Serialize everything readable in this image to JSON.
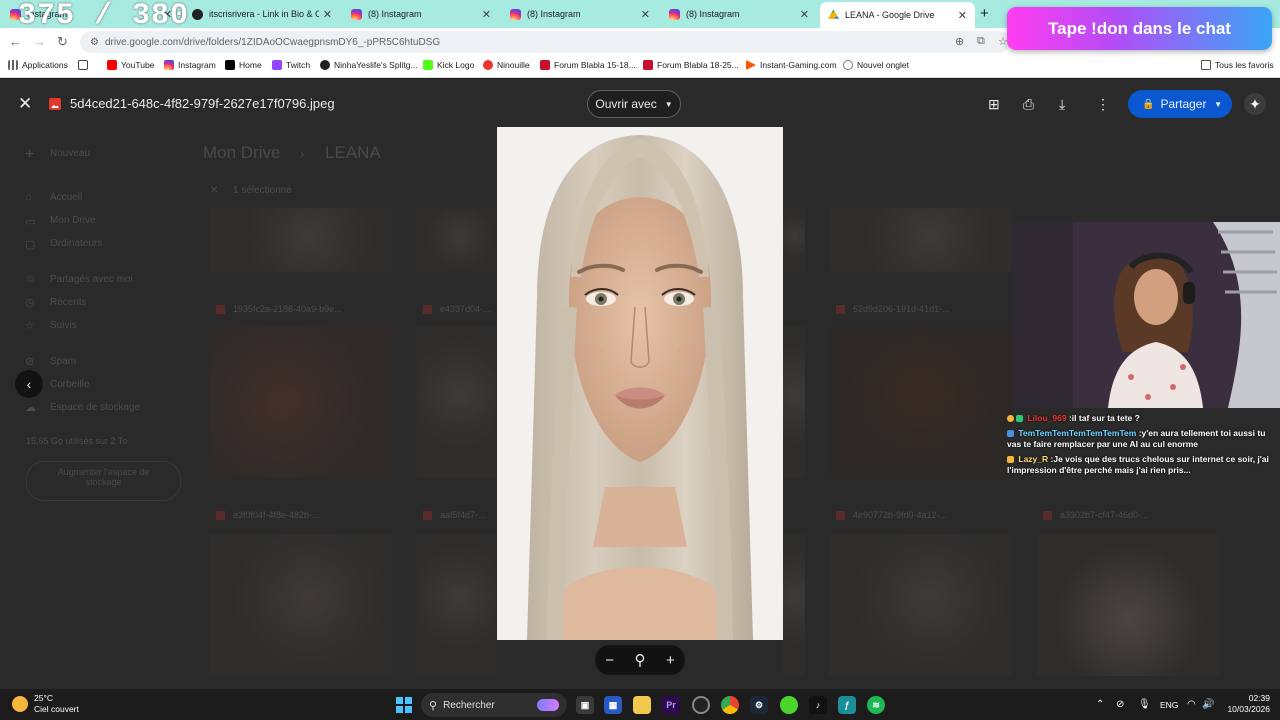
{
  "stream": {
    "counter": "375 / 380",
    "donate_text": "Tape !don dans le chat"
  },
  "browser": {
    "tabs": [
      {
        "title": "Instagram",
        "icon": "instagram-icon"
      },
      {
        "title": "itscrisrivera - Link in Bio & Crea",
        "icon": "linktree-icon"
      },
      {
        "title": "(8) Instagram",
        "icon": "instagram-icon"
      },
      {
        "title": "(8) Instagram",
        "icon": "instagram-icon"
      },
      {
        "title": "(8) Instagram",
        "icon": "instagram-icon"
      },
      {
        "title": "LEANA - Google Drive",
        "icon": "google-drive-icon"
      }
    ],
    "url": "drive.google.com/drive/folders/1ZIDAoOCwaegpnsmDY6_-pPR5C6htuDSG",
    "bookmarks": [
      "Applications",
      "YouTube",
      "Instagram",
      "Home",
      "Twitch",
      "NinhaYeslife's Splitg...",
      "Kick Logo",
      "Ninouille",
      "Forum Blabla 15-18...",
      "Forum Blabla 18-25...",
      "Instant-Gaming.com",
      "Nouvel onglet"
    ],
    "all_bookmarks": "Tous les favoris"
  },
  "drive": {
    "new_button": "Nouveau",
    "sidebar": [
      "Accueil",
      "Mon Drive",
      "Ordinateurs",
      "Partagés avec moi",
      "Récents",
      "Suivis",
      "Spam",
      "Corbeille",
      "Espace de stockage"
    ],
    "storage_text": "15,65 Go utilisés sur 2 To",
    "storage_button_line1": "Augmenter l'espace de",
    "storage_button_line2": "stockage",
    "breadcrumb_root": "Mon Drive",
    "breadcrumb_folder": "LEANA",
    "selection_text": "1 sélectionné",
    "file_names": [
      "1935fc2a-2188-40a9-b9e...",
      "e4337d04-...",
      "52d9d206-191d-41d1-...",
      "e3f0f04f-4f8e-482b-...",
      "aaf5f4d7-...",
      "4e90772b-9fd0-4a12-...",
      "a3302b7-cf47-46d0-..."
    ]
  },
  "viewer": {
    "filename": "5d4ced21-648c-4f82-979f-2627e17f0796.jpeg",
    "open_with": "Ouvrir avec",
    "share": "Partager"
  },
  "chat": [
    {
      "user": "Lilou_969",
      "text": ":il taf sur ta tete ?",
      "color": "#e33333"
    },
    {
      "user": "TemTemTemTemTemTemTem",
      "text": ":y'en aura tellement toi aussi tu vas te faire remplacer par une AI au cul enorme",
      "color": "#6fd3ff"
    },
    {
      "user": "Lazy_R",
      "text": ":Je vois que des trucs chelous sur internet ce soir, j'ai l'impression d'être perché mais j'ai rien pris...",
      "color": "#ffd76a"
    }
  ],
  "taskbar": {
    "temperature": "25°C",
    "weather": "Ciel couvert",
    "search": "Rechercher",
    "lang": "ENG",
    "time": "02:39",
    "date": "10/03/2026"
  },
  "colors": {
    "accent": "#0b57d0",
    "tabbar": "#a6eae0"
  }
}
